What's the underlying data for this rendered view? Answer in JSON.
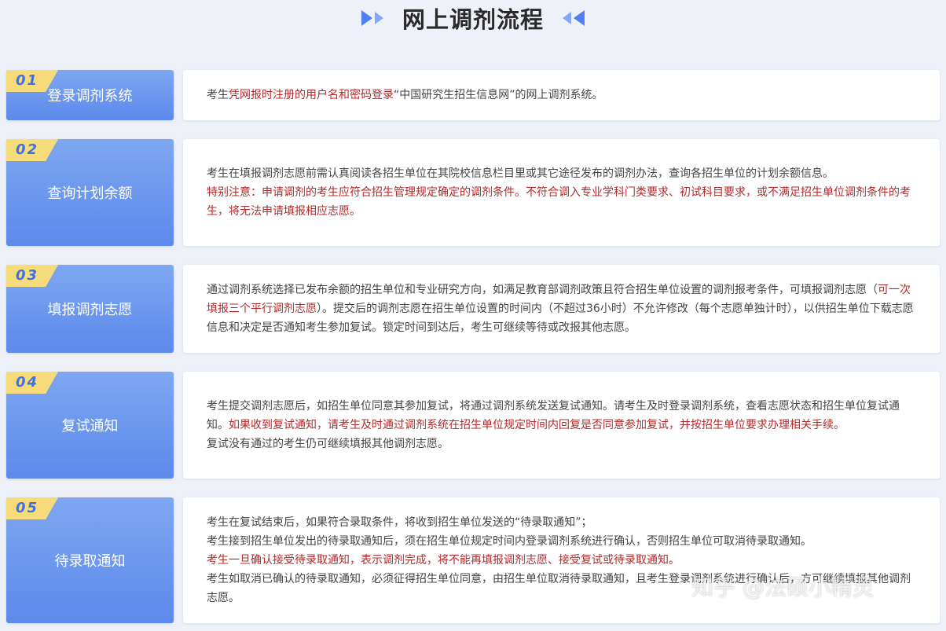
{
  "title": "网上调剂流程",
  "colors": {
    "accent": "#5c89ec",
    "tab": "#f7dc7c",
    "warning": "#b32a2a"
  },
  "steps": [
    {
      "num": "01",
      "name": "登录调剂系统",
      "lines": [
        {
          "segs": [
            {
              "t": "考生",
              "red": false
            },
            {
              "t": "凭网报时注册的用户名和密码登录",
              "red": true
            },
            {
              "t": "“中国研究生招生信息网”的网上调剂系统。",
              "red": false
            }
          ]
        }
      ]
    },
    {
      "num": "02",
      "name": "查询计划余额",
      "lines": [
        {
          "segs": [
            {
              "t": "考生在填报调剂志愿前需认真阅读各招生单位在其院校信息栏目里或其它途径发布的调剂办法，查询各招生单位的计划余额信息。",
              "red": false
            }
          ]
        },
        {
          "segs": [
            {
              "t": "特别注意：申请调剂的考生应符合招生管理规定确定的调剂条件。不符合调入专业学科门类要求、初试科目要求，或不满足招生单位调剂条件的考生，将无法申请填报相应志愿。",
              "red": true
            }
          ]
        }
      ]
    },
    {
      "num": "03",
      "name": "填报调剂志愿",
      "lines": [
        {
          "segs": [
            {
              "t": "通过调剂系统选择已发布余额的招生单位和专业研究方向，如满足教育部调剂政策且符合招生单位设置的调剂报考条件，可填报调剂志愿（",
              "red": false
            },
            {
              "t": "可一次填报三个平行调剂志愿",
              "red": true
            },
            {
              "t": "）。提交后的调剂志愿在招生单位设置的时间内（不超过36小时）不允许修改（每个志愿单独计时），以供招生单位下载志愿信息和决定是否通知考生参加复试。锁定时间到达后，考生可继续等待或改报其他志愿。",
              "red": false
            }
          ]
        }
      ]
    },
    {
      "num": "04",
      "name": "复试通知",
      "lines": [
        {
          "segs": [
            {
              "t": "考生提交调剂志愿后，如招生单位同意其参加复试，将通过调剂系统发送复试通知。请考生及时登录调剂系统，查看志愿状态和招生单位复试通知。",
              "red": false
            },
            {
              "t": "如果收到复试通知，请考生及时通过调剂系统在招生单位规定时间内回复是否同意参加复试，并按招生单位要求办理相关手续。",
              "red": true
            }
          ]
        },
        {
          "segs": [
            {
              "t": "复试没有通过的考生仍可继续填报其他调剂志愿。",
              "red": false
            }
          ]
        }
      ]
    },
    {
      "num": "05",
      "name": "待录取通知",
      "lines": [
        {
          "segs": [
            {
              "t": "考生在复试结束后，如果符合录取条件，将收到招生单位发送的“待录取通知”；",
              "red": false
            }
          ]
        },
        {
          "segs": [
            {
              "t": "考生接到招生单位发出的待录取通知后，须在招生单位规定时间内登录调剂系统进行确认，否则招生单位可取消待录取通知。",
              "red": false
            }
          ]
        },
        {
          "segs": [
            {
              "t": "考生一旦确认接受待录取通知，表示调剂完成，将不能再填报调剂志愿、接受复试或待录取通知。",
              "red": true
            }
          ]
        },
        {
          "segs": [
            {
              "t": "考生如取消已确认的待录取通知，必须征得招生单位同意，由招生单位取消待录取通知，且考生登录调剂系统进行确认后，方可继续填报其他调剂志愿。",
              "red": false
            }
          ]
        }
      ]
    }
  ],
  "watermark": "知乎 @法硕小精灵"
}
